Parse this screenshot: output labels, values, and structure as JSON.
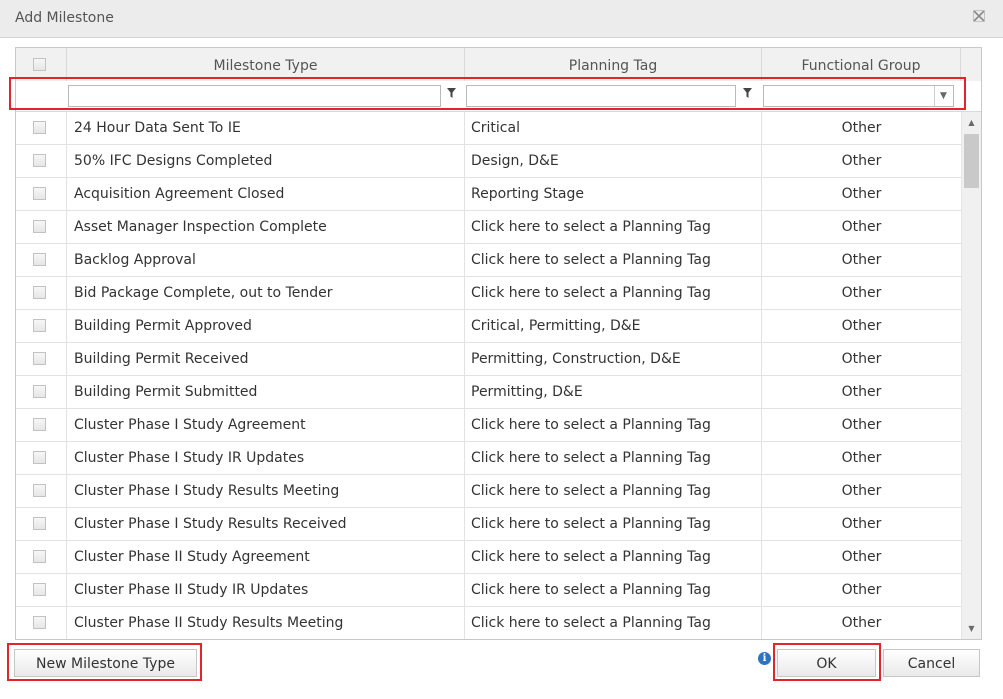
{
  "dialog": {
    "title": "Add Milestone",
    "close_icon": "close-icon"
  },
  "grid": {
    "columns": [
      "Milestone Type",
      "Planning Tag",
      "Functional Group"
    ],
    "filter": {
      "milestone_type_value": "",
      "planning_tag_value": "",
      "functional_group_value": ""
    },
    "rows": [
      {
        "type": "24 Hour Data Sent To IE",
        "tag": "Critical",
        "group": "Other"
      },
      {
        "type": "50% IFC Designs Completed",
        "tag": "Design, D&E",
        "group": "Other"
      },
      {
        "type": "Acquisition Agreement Closed",
        "tag": "Reporting Stage",
        "group": "Other"
      },
      {
        "type": "Asset Manager Inspection Complete",
        "tag": "Click here to select a Planning Tag",
        "group": "Other"
      },
      {
        "type": "Backlog Approval",
        "tag": "Click here to select a Planning Tag",
        "group": "Other"
      },
      {
        "type": "Bid Package Complete, out to Tender",
        "tag": "Click here to select a Planning Tag",
        "group": "Other"
      },
      {
        "type": "Building Permit Approved",
        "tag": "Critical, Permitting, D&E",
        "group": "Other"
      },
      {
        "type": "Building Permit Received",
        "tag": "Permitting, Construction, D&E",
        "group": "Other"
      },
      {
        "type": "Building Permit Submitted",
        "tag": "Permitting, D&E",
        "group": "Other"
      },
      {
        "type": "Cluster Phase I Study Agreement",
        "tag": "Click here to select a Planning Tag",
        "group": "Other"
      },
      {
        "type": "Cluster Phase I Study IR Updates",
        "tag": "Click here to select a Planning Tag",
        "group": "Other"
      },
      {
        "type": "Cluster Phase I Study Results Meeting",
        "tag": "Click here to select a Planning Tag",
        "group": "Other"
      },
      {
        "type": "Cluster Phase I Study Results Received",
        "tag": "Click here to select a Planning Tag",
        "group": "Other"
      },
      {
        "type": "Cluster Phase II Study Agreement",
        "tag": "Click here to select a Planning Tag",
        "group": "Other"
      },
      {
        "type": "Cluster Phase II Study IR Updates",
        "tag": "Click here to select a Planning Tag",
        "group": "Other"
      },
      {
        "type": "Cluster Phase II Study Results Meeting",
        "tag": "Click here to select a Planning Tag",
        "group": "Other"
      }
    ]
  },
  "footer": {
    "new_button": "New Milestone Type",
    "ok_button": "OK",
    "cancel_button": "Cancel"
  },
  "colors": {
    "highlight": "#e0252b",
    "header_bg": "#f1f1f1",
    "info": "#2f74c0"
  }
}
